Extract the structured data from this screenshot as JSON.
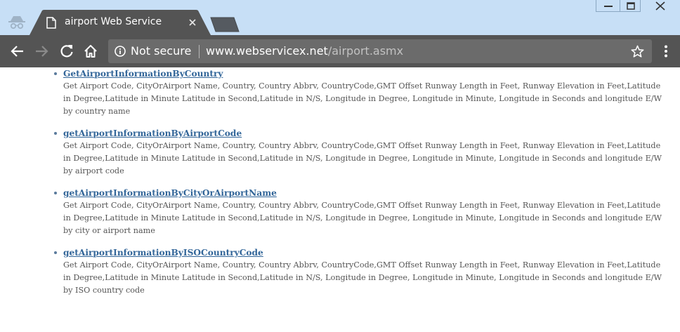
{
  "browser": {
    "tab_title": "airport Web Service",
    "security_label": "Not secure",
    "url_host": "www.webservicex.net",
    "url_path": "/airport.asmx"
  },
  "operations": [
    {
      "name": "GetAirportInformationByCountry",
      "desc_lines": [
        "Get Airport Code, CityOrAirport Name, Country, Country Abbrv, CountryCode,GMT Offset Runway Length in Feet, Runway Elevation in Feet,Latitude",
        "in Degree,Latitude in Minute Latitude in Second,Latitude in N/S, Longitude in Degree, Longitude in Minute, Longitude in Seconds and longitude E/W",
        "by country name"
      ]
    },
    {
      "name": "getAirportInformationByAirportCode",
      "desc_lines": [
        "Get Airport Code, CityOrAirport Name, Country, Country Abbrv, CountryCode,GMT Offset Runway Length in Feet, Runway Elevation in Feet,Latitude",
        "in Degree,Latitude in Minute Latitude in Second,Latitude in N/S, Longitude in Degree, Longitude in Minute, Longitude in Seconds and longitude E/W",
        "by airport code"
      ]
    },
    {
      "name": "getAirportInformationByCityOrAirportName",
      "desc_lines": [
        "Get Airport Code, CityOrAirport Name, Country, Country Abbrv, CountryCode,GMT Offset Runway Length in Feet, Runway Elevation in Feet,Latitude",
        "in Degree,Latitude in Minute Latitude in Second,Latitude in N/S, Longitude in Degree, Longitude in Minute, Longitude in Seconds and longitude E/W",
        "by city or airport name"
      ]
    },
    {
      "name": "getAirportInformationByISOCountryCode",
      "desc_lines": [
        "Get Airport Code, CityOrAirport Name, Country, Country Abbrv, CountryCode,GMT Offset Runway Length in Feet, Runway Elevation in Feet,Latitude",
        "in Degree,Latitude in Minute Latitude in Second,Latitude in N/S, Longitude in Degree, Longitude in Minute, Longitude in Seconds and longitude E/W",
        "by ISO country code"
      ]
    }
  ],
  "colors": {
    "titlebar": "#c7dff6",
    "tab": "#545454",
    "toolbar": "#545454",
    "omnibox": "#6b6b6b",
    "link": "#336699",
    "description": "#555555"
  },
  "icons": [
    "incognito-icon",
    "page-icon",
    "close-icon",
    "new-tab-icon",
    "minimize-icon",
    "maximize-icon",
    "window-close-icon",
    "back-icon",
    "forward-icon",
    "reload-icon",
    "home-icon",
    "info-icon",
    "star-icon",
    "menu-icon"
  ]
}
